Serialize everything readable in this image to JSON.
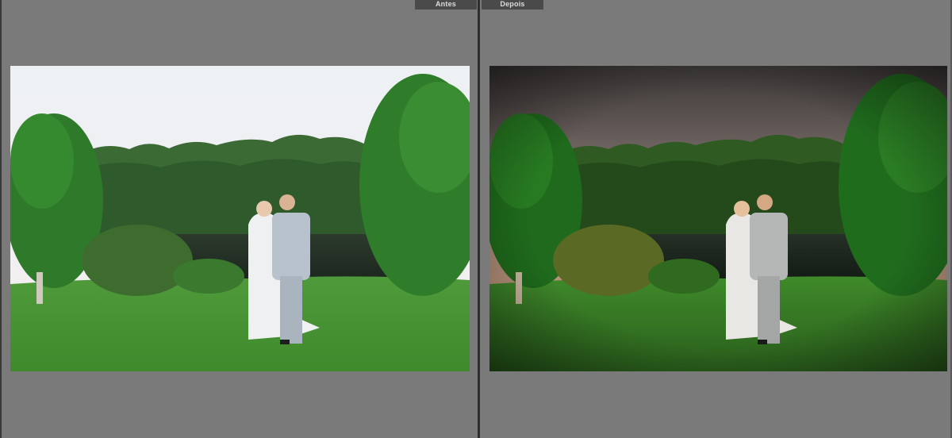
{
  "labels": {
    "before": "Antes",
    "after": "Depois"
  },
  "colors": {
    "background": "#7a7a7a",
    "divider": "#2e2e2e",
    "tab_background": "#4a4a4a",
    "tab_text": "#dcdcdc"
  },
  "photos": {
    "before": {
      "style": "original",
      "sky": "overcast-white"
    },
    "after": {
      "style": "edited",
      "sky": "dramatic-sunset"
    }
  }
}
